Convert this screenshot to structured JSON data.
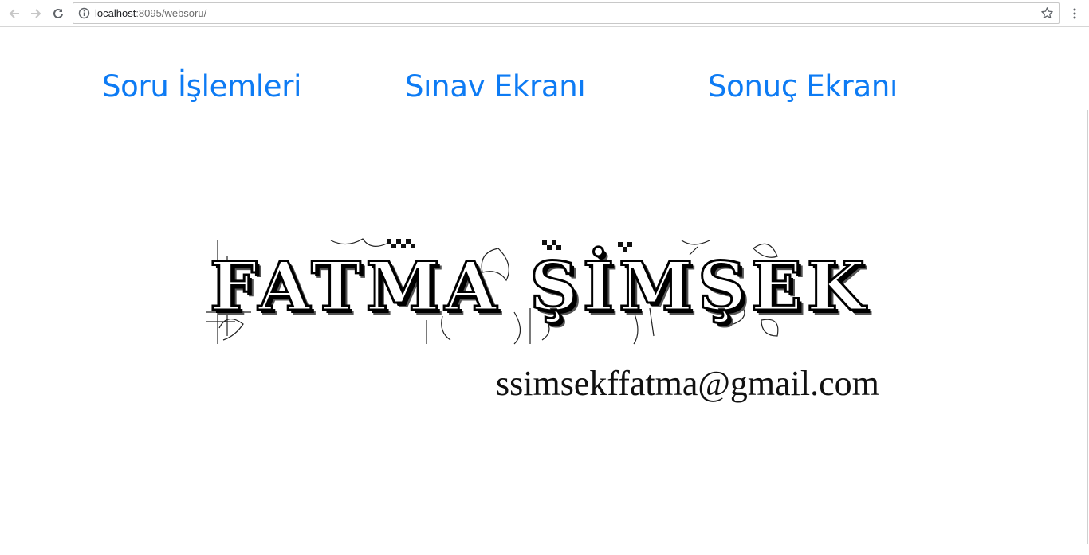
{
  "browser": {
    "url_host": "localhost",
    "url_rest": ":8095/websoru/"
  },
  "nav": {
    "items": [
      {
        "label": "Soru İşlemleri"
      },
      {
        "label": "Sınav Ekranı"
      },
      {
        "label": "Sonuç Ekranı"
      }
    ],
    "link_color": "#0d7bf4"
  },
  "logo": {
    "text": "FATMA ŞİMŞEK"
  },
  "contact": {
    "email": "ssimsekffatma@gmail.com"
  }
}
